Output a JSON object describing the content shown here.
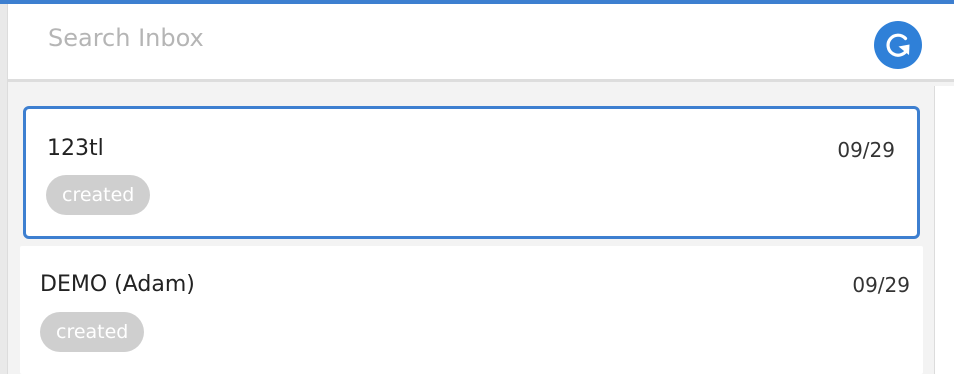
{
  "search": {
    "placeholder": "Search Inbox",
    "value": ""
  },
  "refresh": {
    "icon": "refresh-icon",
    "color": "#2f80d8"
  },
  "accent_color": "#3d7fd0",
  "inbox": {
    "items": [
      {
        "name": "123tl",
        "date": "09/29",
        "status": "created",
        "selected": true
      },
      {
        "name": "DEMO (Adam)",
        "date": "09/29",
        "status": "created",
        "selected": false
      }
    ]
  }
}
